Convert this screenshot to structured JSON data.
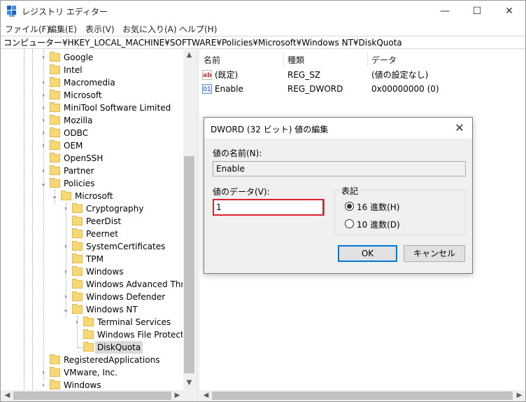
{
  "window": {
    "title": "レジストリ エディター",
    "controls": {
      "minimize": "—",
      "maximize": "☐",
      "close": "✕"
    }
  },
  "menu": [
    "ファイル(F)",
    "編集(E)",
    "表示(V)",
    "お気に入り(A)",
    "ヘルプ(H)"
  ],
  "address": "コンピューター¥HKEY_LOCAL_MACHINE¥SOFTWARE¥Policies¥Microsoft¥Windows NT¥DiskQuota",
  "tree": [
    {
      "label": "Google"
    },
    {
      "label": "Intel"
    },
    {
      "label": "Macromedia"
    },
    {
      "label": "Microsoft"
    },
    {
      "label": "MiniTool Software Limited"
    },
    {
      "label": "Mozilla"
    },
    {
      "label": "ODBC"
    },
    {
      "label": "OEM"
    },
    {
      "label": "OpenSSH"
    },
    {
      "label": "Partner"
    },
    {
      "label": "Policies"
    },
    {
      "label": "Microsoft"
    },
    {
      "label": "Cryptography"
    },
    {
      "label": "PeerDist"
    },
    {
      "label": "Peernet"
    },
    {
      "label": "SystemCertificates"
    },
    {
      "label": "TPM"
    },
    {
      "label": "Windows"
    },
    {
      "label": "Windows Advanced Threat"
    },
    {
      "label": "Windows Defender"
    },
    {
      "label": "Windows NT"
    },
    {
      "label": "Terminal Services"
    },
    {
      "label": "Windows File Protection"
    },
    {
      "label": "DiskQuota"
    },
    {
      "label": "RegisteredApplications"
    },
    {
      "label": "VMware, Inc."
    },
    {
      "label": "Windows"
    }
  ],
  "list": {
    "headers": {
      "name": "名前",
      "type": "種類",
      "data": "データ"
    },
    "rows": [
      {
        "icon": "string-value-icon",
        "icon_text": "ab",
        "name": "(既定)",
        "type": "REG_SZ",
        "data": "(値の設定なし)"
      },
      {
        "icon": "binary-value-icon",
        "icon_text": "01",
        "name": "Enable",
        "type": "REG_DWORD",
        "data": "0x00000000 (0)"
      }
    ]
  },
  "dialog": {
    "title": "DWORD (32 ビット) 値の編集",
    "close": "✕",
    "name_label": "値の名前(N):",
    "name_value": "Enable",
    "data_label": "値のデータ(V):",
    "data_value": "1",
    "base_label": "表記",
    "hex_label": "16 進数(H)",
    "dec_label": "10 進数(D)",
    "ok": "OK",
    "cancel": "キャンセル"
  },
  "colors": {
    "accent": "#0078d7",
    "highlight_border": "#e0202a",
    "folder": "#f8d775"
  }
}
